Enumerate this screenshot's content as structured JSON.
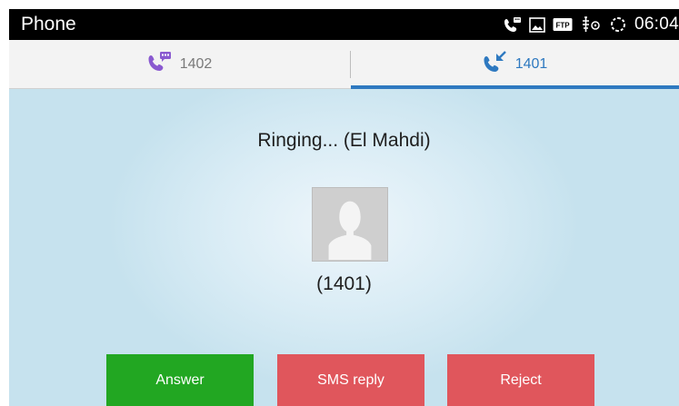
{
  "status_bar": {
    "app_title": "Phone",
    "icons": [
      "voicemail-icon",
      "image-icon",
      "ftp-icon",
      "usb-debug-icon",
      "sync-icon"
    ],
    "ftp_badge": "FTP",
    "time": "06:04"
  },
  "tabs": [
    {
      "label": "1402",
      "icon": "call-message-icon",
      "active": false
    },
    {
      "label": "1401",
      "icon": "incoming-call-icon",
      "active": true
    }
  ],
  "call": {
    "status": "Ringing... (El Mahdi)",
    "number": "(1401)",
    "avatar_icon": "default-avatar-icon"
  },
  "actions": {
    "answer": "Answer",
    "sms_reply": "SMS reply",
    "reject": "Reject"
  },
  "colors": {
    "answer": "#22a722",
    "reject": "#e0565c",
    "accent": "#2e79c0",
    "tab_icon_inactive": "#8a5ad0"
  }
}
